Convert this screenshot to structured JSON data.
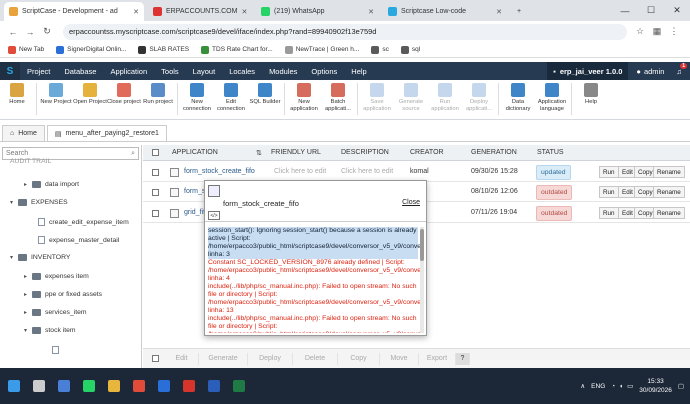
{
  "browser": {
    "tabs": [
      {
        "title": "ScriptCase - Development - ad",
        "active": true,
        "color": "#e8a33d"
      },
      {
        "title": "ERPACCOUNTS.COM",
        "active": false,
        "color": "#d33"
      },
      {
        "title": "(219) WhatsApp",
        "active": false,
        "color": "#25d366"
      },
      {
        "title": "Scriptcase Low-code",
        "active": false,
        "color": "#2aa8e0"
      }
    ],
    "url": "erpaccountss.myscriptcase.com/scriptcase9/devel/iface/index.php?rand=8994090​2f13e759d",
    "bookmarks": [
      "New Tab",
      "SignerDigital Onlin...",
      "SLAB RATES",
      "TDS Rate Chart for...",
      "NewTrace | Green h...",
      "sc",
      "sql"
    ]
  },
  "menubar": {
    "logo": "S",
    "items": [
      "Project",
      "Database",
      "Application",
      "Tools",
      "Layout",
      "Locales",
      "Modules",
      "Options",
      "Help"
    ],
    "project": "erp_jai_veer 1.0.0",
    "user": "admin",
    "badge": "1"
  },
  "toolbar": [
    {
      "label": "Home",
      "color": "#d9a441",
      "disabled": false
    },
    {
      "label": "New Project",
      "color": "#6aa9d8",
      "disabled": false
    },
    {
      "label": "Open Project",
      "color": "#e5b33b",
      "disabled": false
    },
    {
      "label": "Close project",
      "color": "#e06b5a",
      "disabled": false
    },
    {
      "label": "Run project",
      "color": "#5a8dc8",
      "disabled": false
    },
    {
      "label": "New connection",
      "color": "#3f86c9",
      "disabled": false
    },
    {
      "label": "Edit connection",
      "color": "#3f86c9",
      "disabled": false
    },
    {
      "label": "SQL Builder",
      "color": "#3f86c9",
      "disabled": false
    },
    {
      "label": "New application",
      "color": "#d66c5b",
      "disabled": false
    },
    {
      "label": "Batch applicati...",
      "color": "#d66c5b",
      "disabled": false
    },
    {
      "label": "Save application",
      "color": "#5a8dc8",
      "disabled": true
    },
    {
      "label": "Generate source",
      "color": "#5a8dc8",
      "disabled": true
    },
    {
      "label": "Run application",
      "color": "#5a8dc8",
      "disabled": true
    },
    {
      "label": "Deploy applicati...",
      "color": "#5a8dc8",
      "disabled": true
    },
    {
      "label": "Data dictionary",
      "color": "#3f86c9",
      "disabled": false
    },
    {
      "label": "Application language",
      "color": "#3f86c9",
      "disabled": false
    },
    {
      "label": "Help",
      "color": "#888888",
      "disabled": false
    }
  ],
  "tabs": [
    {
      "label": "Home"
    },
    {
      "label": "menu_after_paying2_restore1"
    }
  ],
  "sidebar": {
    "search_placeholder": "Search",
    "items": [
      {
        "label": "AUDIT TRAIL",
        "type": "cut",
        "indent": 0
      },
      {
        "label": "data import",
        "type": "folder",
        "indent": 1
      },
      {
        "label": "EXPENSES",
        "type": "folder-open",
        "indent": 0
      },
      {
        "label": "create_edit_expense_item",
        "type": "doc",
        "indent": 2
      },
      {
        "label": "expense_master_detail",
        "type": "doc",
        "indent": 2
      },
      {
        "label": "INVENTORY",
        "type": "folder-open",
        "indent": 0
      },
      {
        "label": "expenses item",
        "type": "folder",
        "indent": 1
      },
      {
        "label": "ppe or fixed assets",
        "type": "folder",
        "indent": 1
      },
      {
        "label": "services_item",
        "type": "folder",
        "indent": 1
      },
      {
        "label": "stock item",
        "type": "folder-open",
        "indent": 1
      },
      {
        "label": "",
        "type": "doc",
        "indent": 3
      }
    ]
  },
  "grid": {
    "headers": [
      "APPLICATION",
      "FRIENDLY URL",
      "DESCRIPTION",
      "CREATOR",
      "GENERATION",
      "STATUS"
    ],
    "placeholder": "Click here to edit",
    "rows": [
      {
        "app": "form_stock_create_fifo",
        "creator": "komal",
        "generation": "09/30/26 15:28",
        "status": "updated"
      },
      {
        "app": "form_st",
        "creator": "",
        "generation": "08/10/26 12:06",
        "status": "outdated"
      },
      {
        "app": "grid_fif",
        "creator": "",
        "generation": "07/11/26 19:04",
        "status": "outdated"
      }
    ],
    "row_buttons": [
      "Run",
      "Edit",
      "Copy",
      "Rename"
    ],
    "footer_buttons": [
      "Edit",
      "Generate",
      "Deploy",
      "Delete",
      "Copy",
      "Move",
      "Export",
      "?"
    ]
  },
  "popup": {
    "title": "form_stock_create_fifo",
    "close": "Close",
    "icon_code": "</>",
    "lines": [
      {
        "text": "session_start(): Ignoring session_start() because a session is already active | Script: /home/erpacco3/public_html/scriptcase9/devel/conversor_v5_v9/conver linha: 3",
        "highlight": true
      },
      {
        "text": "Constant SC_LOCKED_VERSION_8976 already defined | Script: /home/erpacco3/public_html/scriptcase9/devel/conversor_v5_v9/conver linha: 4",
        "highlight": false
      },
      {
        "text": "include(../lib/php/sc_manual.inc.php): Failed to open stream: No such file or directory | Script: /home/erpacco3/public_html/scriptcase9/devel/conversor_v5_v9/conver linha: 13",
        "highlight": false
      },
      {
        "text": "include(../lib/php/sc_manual.inc.php): Failed to open stream: No such file or directory | Script: /home/erpacco3/public_html/scriptcase9/devel/conversor_v5_v9/conver",
        "highlight": false
      }
    ]
  },
  "taskbar": {
    "icons": [
      {
        "name": "start-icon",
        "color": "#3a9be8"
      },
      {
        "name": "search-icon",
        "color": "#cccccc"
      },
      {
        "name": "file-explorer-icon",
        "color": "#4a7fd8"
      },
      {
        "name": "whatsapp-icon",
        "color": "#25d366"
      },
      {
        "name": "folder-icon",
        "color": "#e8b53d"
      },
      {
        "name": "chrome-icon",
        "color": "#e04b3a"
      },
      {
        "name": "mail-icon",
        "color": "#2a6fd8"
      },
      {
        "name": "acrobat-icon",
        "color": "#d5352b"
      },
      {
        "name": "word-icon",
        "color": "#2b5eb8"
      },
      {
        "name": "excel-icon",
        "color": "#1f7a45"
      }
    ],
    "language": "ENG",
    "time": "15:33",
    "date": "30/09/2026"
  }
}
